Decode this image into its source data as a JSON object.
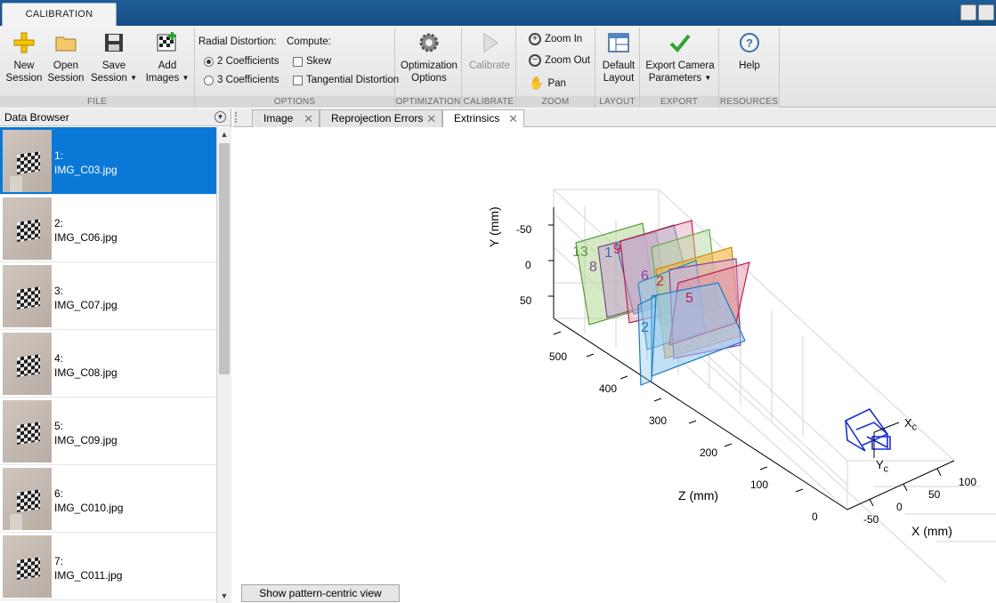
{
  "window": {
    "tab_label": "CALIBRATION"
  },
  "ribbon": {
    "file": {
      "group_label": "FILE",
      "new_session": [
        "New",
        "Session"
      ],
      "open_session": [
        "Open",
        "Session"
      ],
      "save_session": [
        "Save",
        "Session"
      ],
      "add_images": [
        "Add",
        "Images"
      ]
    },
    "options": {
      "group_label": "OPTIONS",
      "radial_label": "Radial Distortion:",
      "compute_label": "Compute:",
      "radial_2": "2 Coefficients",
      "radial_3": "3 Coefficients",
      "skew": "Skew",
      "tangential": "Tangential Distortion"
    },
    "optimization": {
      "group_label": "OPTIMIZATION",
      "button": [
        "Optimization",
        "Options"
      ]
    },
    "calibrate": {
      "group_label": "CALIBRATE",
      "button": "Calibrate"
    },
    "zoom": {
      "group_label": "ZOOM",
      "zoom_in": "Zoom In",
      "zoom_out": "Zoom Out",
      "pan": "Pan"
    },
    "layout": {
      "group_label": "LAYOUT",
      "button": [
        "Default",
        "Layout"
      ]
    },
    "export": {
      "group_label": "EXPORT",
      "button": [
        "Export Camera",
        "Parameters"
      ]
    },
    "resources": {
      "group_label": "RESOURCES",
      "button": "Help"
    }
  },
  "data_browser": {
    "title": "Data Browser",
    "items": [
      {
        "index": "1:",
        "file": "IMG_C03.jpg"
      },
      {
        "index": "2:",
        "file": "IMG_C06.jpg"
      },
      {
        "index": "3:",
        "file": "IMG_C07.jpg"
      },
      {
        "index": "4:",
        "file": "IMG_C08.jpg"
      },
      {
        "index": "5:",
        "file": "IMG_C09.jpg"
      },
      {
        "index": "6:",
        "file": "IMG_C010.jpg"
      },
      {
        "index": "7:",
        "file": "IMG_C011.jpg"
      }
    ]
  },
  "doc_tabs": [
    "Image",
    "Reprojection Errors",
    "Extrinsics"
  ],
  "plot": {
    "y_label": "Y (mm)",
    "z_label": "Z (mm)",
    "x_label": "X (mm)",
    "y_ticks": [
      "-50",
      "0",
      "50"
    ],
    "z_ticks": [
      "500",
      "400",
      "300",
      "200",
      "100",
      "0"
    ],
    "x_ticks": [
      "-50",
      "0",
      "50",
      "100"
    ],
    "camera_x": "X",
    "camera_y": "Y",
    "camera_sub": "c",
    "pattern_labels": [
      "13",
      "8",
      "1",
      "9",
      "6",
      "2",
      "5",
      "2"
    ],
    "button": "Show pattern-centric view"
  },
  "colors": {
    "accent": "#0a78d7",
    "titlebar": "#1f5d97",
    "camera": "#1a2fd0"
  }
}
